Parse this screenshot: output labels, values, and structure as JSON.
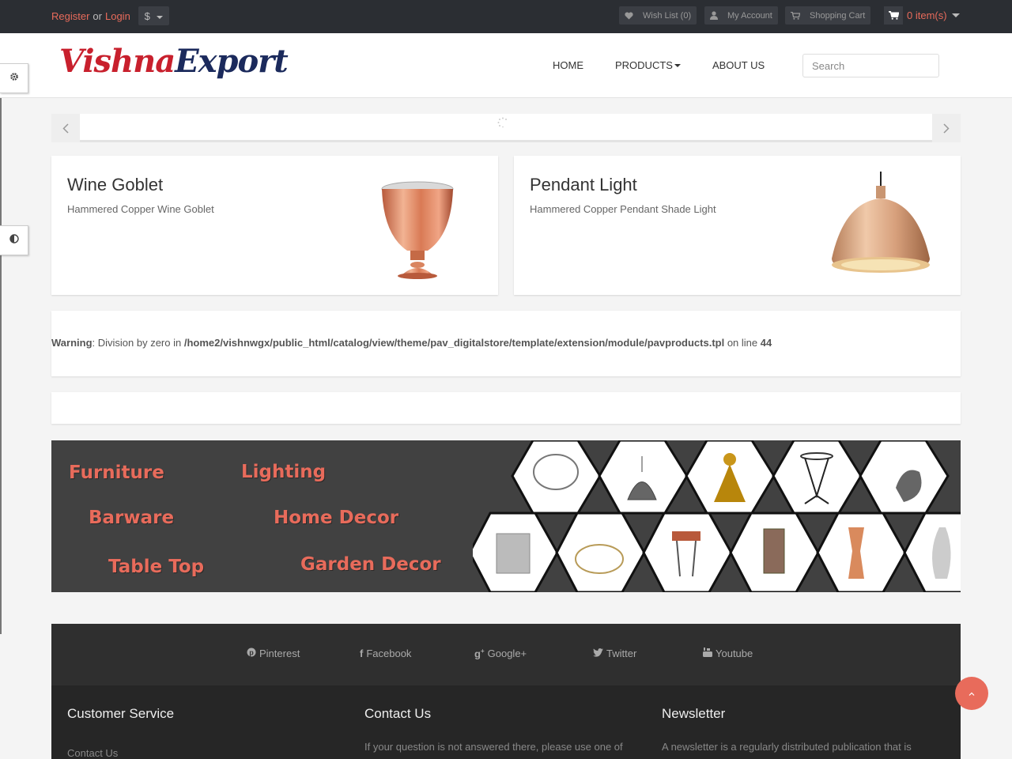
{
  "topbar": {
    "register": "Register",
    "or": "or",
    "login": "Login",
    "currency": "$",
    "wishlist": "Wish List (0)",
    "account": "My Account",
    "cart_link": "Shopping Cart",
    "cart_items": "0 item(s)"
  },
  "header": {
    "logo_word1": "Vishna",
    "logo_word2": "Export",
    "nav": {
      "home": "HOME",
      "products": "PRODUCTS",
      "about": "ABOUT US"
    },
    "search_placeholder": "Search"
  },
  "products": [
    {
      "title": "Wine Goblet",
      "subtitle": "Hammered Copper Wine Goblet"
    },
    {
      "title": "Pendant Light",
      "subtitle": "Hammered Copper Pendant Shade Light"
    }
  ],
  "warning": {
    "label": "Warning",
    "message": ": Division by zero in ",
    "path": "/home2/vishnwgx/public_html/catalog/view/theme/pav_digitalstore/template/extension/module/pavproducts.tpl",
    "on_line": " on line ",
    "line": "44"
  },
  "banner": {
    "categories": [
      "Furniture",
      "Lighting",
      "Barware",
      "Home Decor",
      "Table Top",
      "Garden Decor"
    ]
  },
  "social": [
    "Pinterest",
    "Facebook",
    "Google+",
    "Twitter",
    "Youtube"
  ],
  "footer": {
    "customer_service": {
      "heading": "Customer Service",
      "first_link": "Contact Us"
    },
    "contact": {
      "heading": "Contact Us",
      "text": "If your question is not answered there, please use one of"
    },
    "newsletter": {
      "heading": "Newsletter",
      "text": "A newsletter is a regularly distributed publication that is"
    }
  },
  "colors": {
    "accent": "#e86b5b",
    "topbar": "#2b2e33",
    "footer": "#2d2d2d"
  }
}
